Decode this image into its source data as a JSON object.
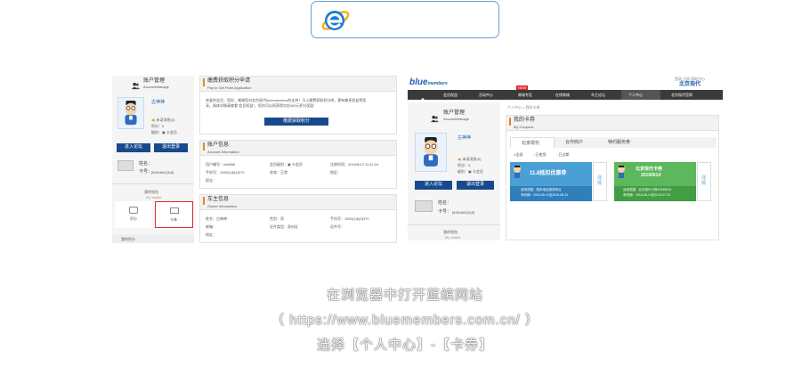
{
  "browser": {
    "icon": "ie-icon"
  },
  "left_shot": {
    "sidebar": {
      "account_title": "账户管理",
      "account_title_en": "AccountManage",
      "username": "古神神",
      "status": "未读消息(0)",
      "points_label": "积分：0",
      "level_label": "级别：▣ 卡会员",
      "btn_forum": "进入论坛",
      "btn_logout": "退出登录",
      "name_label": "姓名：",
      "card_label": "卡号：",
      "card_value": "[6261860(3)8]",
      "wallet_title": "我的钱包",
      "wallet_title_en": "My Wallet",
      "wallet_points": "积分",
      "wallet_card": "卡券",
      "next_title": "我的积分"
    },
    "points_apply": {
      "title": "缴费获取积分申请",
      "subtitle": "Pay to Get Point Application",
      "body_line1": "亲爱的会员，您好。感谢您对北京现代bluemembers的支持！马上缴费获取积分吧，更有尊享权益等您",
      "body_line2": "享。具体详情请查看\"会员权益\"，您也可以再获得对应400元积分奖励",
      "button": "缴费获取积分"
    },
    "account_info": {
      "title": "账户信息",
      "subtitle": "Account Information",
      "user_no_label": "用户编号：",
      "user_no": "sh6f6f6",
      "member_level_label": "会员级别：",
      "member_level": "▣ 卡会员",
      "register_label": "注册时间：",
      "register_value": "2016/6/12 11:41:24",
      "phone_label": "手机号：",
      "phone": "1590(1)6(4)370",
      "status_label": "状态：",
      "status": "正常",
      "city_label": "地区：",
      "job_label": "职业："
    },
    "owner_info": {
      "title": "车主信息",
      "subtitle": "Owner Information",
      "name_label": "姓名：",
      "name_value": "古神神",
      "sex_label": "性别：",
      "sex_value": "男",
      "mobile_label": "手机号：",
      "mobile_value": "1590(1)6(4)370",
      "email_label": "邮箱：",
      "id_type_label": "证件类型：",
      "id_type_value": "身份证",
      "id_no_label": "证件号：",
      "address_label": "地址："
    }
  },
  "right_shot": {
    "header": {
      "logo_text": "blue",
      "logo_sub": "members",
      "brand": "北京现代",
      "top_links": "登录  注册  帮助中心"
    },
    "nav": [
      {
        "label": "首页"
      },
      {
        "label": "会员权益"
      },
      {
        "label": "活动中心"
      },
      {
        "label": "商城专区",
        "badge": "NEW"
      },
      {
        "label": "在线商城"
      },
      {
        "label": "车主论坛"
      },
      {
        "label": "个人中心"
      },
      {
        "label": "北京现代官网"
      }
    ],
    "breadcrumb": "个人中心 > 我的卡券",
    "sidebar": {
      "account_title": "账户管理",
      "account_title_en": "AccountManage",
      "username": "古神神",
      "status": "未读消息(0)",
      "points_label": "积分：0",
      "level_label": "级别：▣ 卡会员",
      "btn_forum": "进入论坛",
      "btn_logout": "退出登录",
      "name_label": "姓名：",
      "card_label": "卡号：",
      "card_value": "[6261860(3)8]",
      "wallet_title": "我的钱包",
      "wallet_title_en": "My Wallet"
    },
    "coupons": {
      "title": "我的卡券",
      "subtitle": "My Coupons",
      "tabs": [
        "北京现代",
        "合作商户",
        "特约服务券"
      ],
      "subtabs": [
        "全部",
        "已使用",
        "已过期"
      ],
      "coupon1_title": "11.8抵扣优惠券",
      "coupon1_desc1": "适用范围：限本地区服务网点",
      "coupon1_desc2": "有效期：2016-06-01至2016-08-31",
      "coupon1_detail": "详情",
      "coupon2_title1": "北京现代卡券",
      "coupon2_title2": "20160614",
      "coupon2_desc1": "适用范围：北京现代卡券20160614",
      "coupon2_desc2": "有效期：2016-06-14至2016-07-31",
      "coupon2_detail": "详情"
    }
  },
  "caption": {
    "line1": "在浏览器中打开蓝缤网站",
    "line2": "（ https://www.bluemembers.com.cn/ ）",
    "line3": "选择【个人中心】-【卡券】"
  },
  "colors": {
    "brand_blue": "#174a8c",
    "nav_dark": "#3a3a3a",
    "coupon_blue": "#4a9fd5",
    "coupon_green": "#5cb85c",
    "accent_orange": "#e4871e",
    "highlight_red": "#e0292b"
  }
}
